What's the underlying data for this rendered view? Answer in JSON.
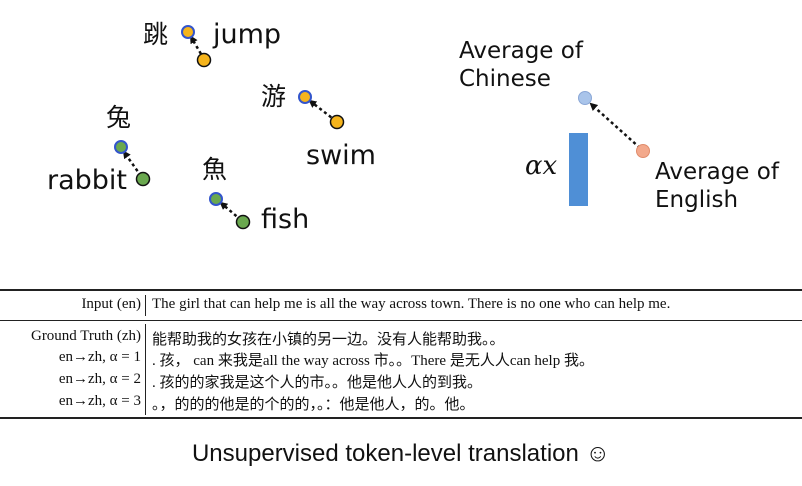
{
  "diagram": {
    "words": {
      "zh_jump": "跳",
      "en_jump": "jump",
      "zh_swim": "游",
      "en_swim": "swim",
      "zh_rabbit": "兔",
      "en_rabbit": "rabbit",
      "zh_fish": "魚",
      "en_fish": "fish"
    },
    "avg_chinese": [
      "Average of",
      "Chinese"
    ],
    "avg_english": [
      "Average of",
      "English"
    ],
    "alpha_label": "αx",
    "colors": {
      "chinese_point": "#3355cc",
      "yellow": "#f5b41c",
      "green": "#6aa84f",
      "avg_chinese": "#a9c4ea",
      "avg_english": "#f3a98c",
      "bar": "#4f8fd6"
    }
  },
  "table": {
    "input_header": "Input (en)",
    "input_text": "The girl that can help me is all the way across town. There is no one who can help me.",
    "rows": [
      {
        "header": "Ground Truth (zh)",
        "text": "能帮助我的女孩在小镇的另一边。没有人能帮助我。。"
      },
      {
        "header": "en→zh, α = 1",
        "text": ". 孩， can 来我是all the way across 市。。There 是无人人can help 我。"
      },
      {
        "header": "en→zh, α = 2",
        "text": ". 孩的的家我是这个人的市。。他是他人人的到我。"
      },
      {
        "header": "en→zh, α = 3",
        "text": "。，的的的他是的个的的，。：他是他人，的。他。"
      }
    ]
  },
  "caption": "Unsupervised token-level translation ☺"
}
